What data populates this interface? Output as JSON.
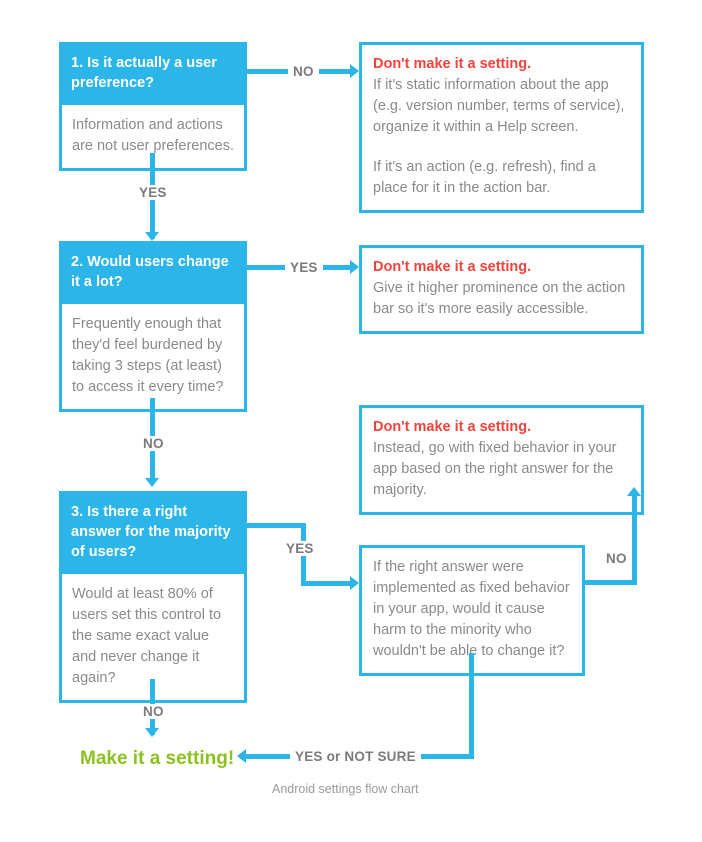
{
  "caption": "Android settings flow chart",
  "colors": {
    "blue": "#2cb5e8",
    "red": "#f4433c",
    "green": "#8bc220",
    "gray_text": "#8a8a8a",
    "label_gray": "#7a7a7a",
    "white": "#ffffff"
  },
  "decisions": [
    {
      "id": "q1",
      "heading": "1. Is it actually a user preference?",
      "detail": "Information and actions are not user preferences."
    },
    {
      "id": "q2",
      "heading": "2. Would users change it a lot?",
      "detail": "Frequently enough that they'd feel burdened by taking 3 steps (at least) to access it every time?"
    },
    {
      "id": "q3",
      "heading": "3. Is there a right answer for the majority of users?",
      "detail": "Would at least 80% of users set this control to the same exact value and never change it again?"
    }
  ],
  "sub_decision": {
    "id": "q4",
    "detail": "If the right answer were implemented as fixed behavior in your app, would it cause harm to the minority who wouldn't be able to change it?"
  },
  "results": [
    {
      "id": "r1",
      "title": "Don't make it a setting.",
      "paragraph1": "If it's static information about the app (e.g. version number, terms of service), organize it within a Help screen.",
      "paragraph2": "If it's an action (e.g. refresh), find a place for it in the action bar."
    },
    {
      "id": "r2",
      "title": "Don't make it a setting.",
      "paragraph1": "Give it higher prominence on the action bar so it's more easily accessible."
    },
    {
      "id": "r3",
      "title": "Don't make it a setting.",
      "paragraph1": "Instead, go with fixed behavior in your app based on the right answer for the majority."
    }
  ],
  "edges": {
    "q1_no": "NO",
    "q1_yes": "YES",
    "q2_yes": "YES",
    "q2_no": "NO",
    "q3_yes": "YES",
    "q3_no": "NO",
    "q4_no": "NO",
    "q4_yes": "YES or NOT SURE"
  },
  "terminal": "Make it a setting!"
}
